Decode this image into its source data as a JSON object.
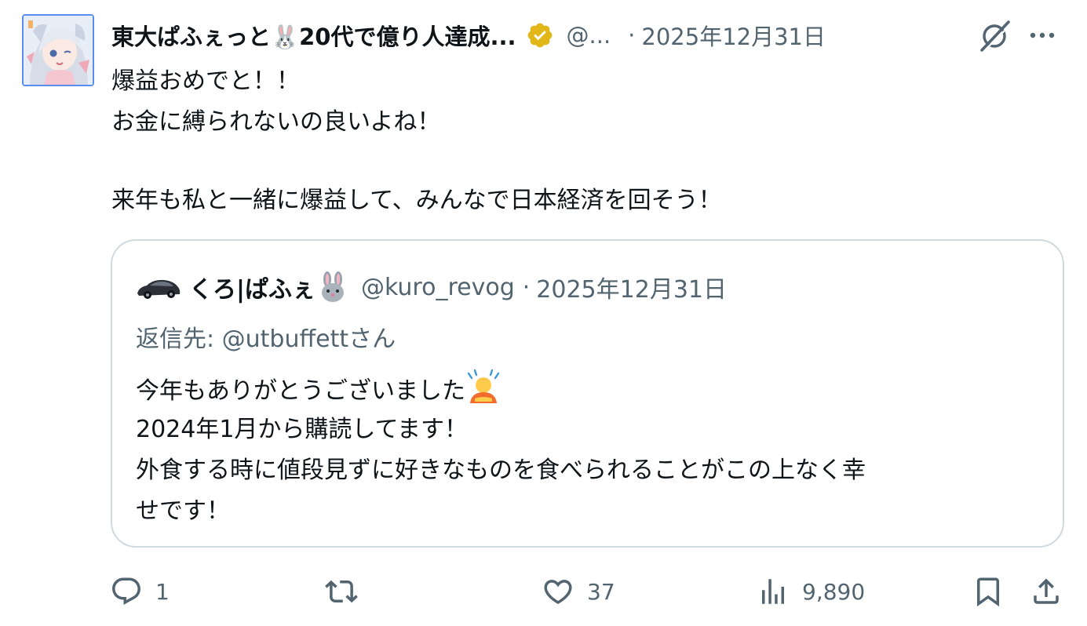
{
  "post": {
    "display_name": "東大ぱふぇっと🐰20代で億り人達成...",
    "handle": "@...",
    "separator": "·",
    "date": "2025年12月31日",
    "lines": [
      "爆益おめでと！！",
      "お金に縛られないの良いよね！",
      "",
      "来年も私と一緒に爆益して、みんなで日本経済を回そう！"
    ]
  },
  "quote": {
    "display_name": "くろ|ぱふぇ",
    "handle": "@kuro_revog",
    "separator": "·",
    "date": "2025年12月31日",
    "reply_prefix": "返信先: ",
    "reply_handle": "@utbuffett",
    "reply_suffix": "さん",
    "line1": "今年もありがとうございました",
    "line2": "2024年1月から購読してます！",
    "line3": "外食する時に値段見ずに好きなものを食べられることがこの上なく幸",
    "line4": "せです！"
  },
  "actions": {
    "reply_count": "1",
    "repost_count": "",
    "like_count": "37",
    "view_count": "9,890"
  },
  "icons": {
    "avatar": "anime-avatar",
    "verified": "verified-badge-icon",
    "grok": "grok-icon",
    "more": "more-icon",
    "car": "car-avatar-icon",
    "rabbit": "rabbit-emoji",
    "bowing": "bowing-person-emoji",
    "reply": "reply-icon",
    "repost": "repost-icon",
    "like": "like-icon",
    "views": "views-icon",
    "bookmark": "bookmark-icon",
    "share": "share-icon"
  },
  "colors": {
    "text_primary": "#0f1419",
    "text_secondary": "#536471",
    "border": "#cfd9de",
    "verified_gold": "#e2b719",
    "avatar_border": "#5b8def"
  }
}
